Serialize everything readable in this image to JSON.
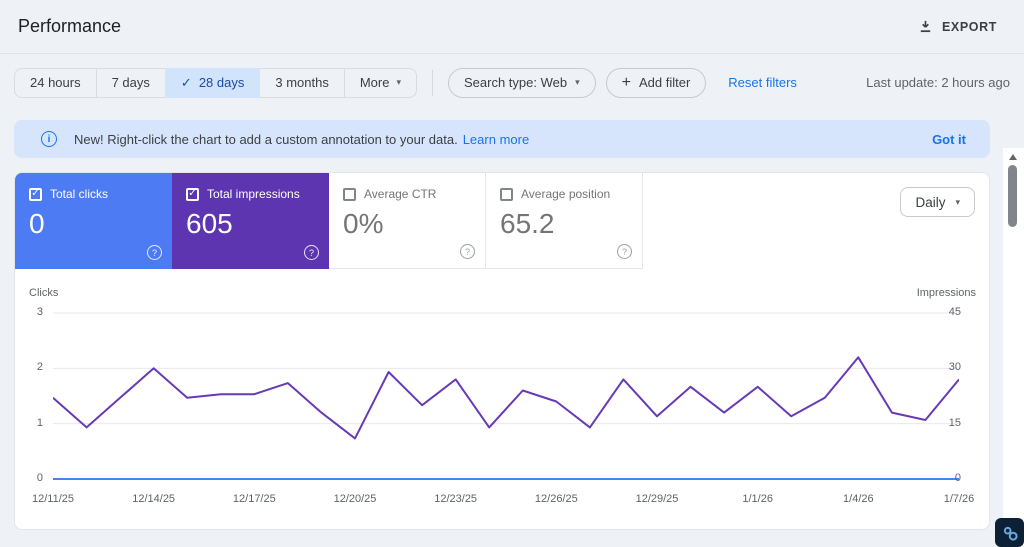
{
  "header": {
    "title": "Performance",
    "export_label": "EXPORT"
  },
  "filters": {
    "date_ranges": [
      {
        "label": "24 hours",
        "selected": false
      },
      {
        "label": "7 days",
        "selected": false
      },
      {
        "label": "28 days",
        "selected": true
      },
      {
        "label": "3 months",
        "selected": false
      },
      {
        "label": "More",
        "selected": false
      }
    ],
    "search_type_label": "Search type: Web",
    "add_filter_label": "Add filter",
    "reset_filters_label": "Reset filters",
    "last_update": "Last update: 2 hours ago"
  },
  "banner": {
    "text": "New! Right-click the chart to add a custom annotation to your data.",
    "learn_more_label": "Learn more",
    "dismiss_label": "Got it"
  },
  "metrics": {
    "cards": [
      {
        "label": "Total clicks",
        "value": "0",
        "checked": true
      },
      {
        "label": "Total impressions",
        "value": "605",
        "checked": true
      },
      {
        "label": "Average CTR",
        "value": "0%",
        "checked": false
      },
      {
        "label": "Average position",
        "value": "65.2",
        "checked": false
      }
    ],
    "granularity": "Daily"
  },
  "chart_data": {
    "type": "line",
    "title": "",
    "x": [
      "12/11/25",
      "12/12/25",
      "12/13/25",
      "12/14/25",
      "12/15/25",
      "12/16/25",
      "12/17/25",
      "12/18/25",
      "12/19/25",
      "12/20/25",
      "12/21/25",
      "12/22/25",
      "12/23/25",
      "12/24/25",
      "12/25/25",
      "12/26/25",
      "12/27/25",
      "12/28/25",
      "12/29/25",
      "12/30/25",
      "12/31/25",
      "1/1/26",
      "1/2/26",
      "1/3/26",
      "1/4/26",
      "1/5/26",
      "1/6/26",
      "1/7/26"
    ],
    "x_ticks": [
      {
        "index": 0,
        "label": "12/11/25"
      },
      {
        "index": 3,
        "label": "12/14/25"
      },
      {
        "index": 6,
        "label": "12/17/25"
      },
      {
        "index": 9,
        "label": "12/20/25"
      },
      {
        "index": 12,
        "label": "12/23/25"
      },
      {
        "index": 15,
        "label": "12/26/25"
      },
      {
        "index": 18,
        "label": "12/29/25"
      },
      {
        "index": 21,
        "label": "1/1/26"
      },
      {
        "index": 24,
        "label": "1/4/26"
      },
      {
        "index": 27,
        "label": "1/7/26"
      }
    ],
    "series": [
      {
        "name": "Total clicks",
        "axis": "left",
        "color": "#4285f4",
        "values": [
          0,
          0,
          0,
          0,
          0,
          0,
          0,
          0,
          0,
          0,
          0,
          0,
          0,
          0,
          0,
          0,
          0,
          0,
          0,
          0,
          0,
          0,
          0,
          0,
          0,
          0,
          0,
          0
        ]
      },
      {
        "name": "Total impressions",
        "axis": "right",
        "color": "#673ab7",
        "values": [
          22,
          14,
          22,
          30,
          22,
          23,
          23,
          26,
          18,
          11,
          29,
          20,
          27,
          14,
          24,
          21,
          14,
          27,
          17,
          25,
          18,
          25,
          17,
          22,
          33,
          18,
          16,
          27
        ]
      }
    ],
    "left_axis": {
      "label": "Clicks",
      "range": [
        0,
        3
      ],
      "ticks": [
        0,
        1,
        2,
        3
      ]
    },
    "right_axis": {
      "label": "Impressions",
      "range": [
        0,
        45
      ],
      "ticks": [
        0,
        15,
        30,
        45
      ]
    },
    "grid": true,
    "legend_position": "none"
  },
  "icons": {
    "check": "✓",
    "caret": "▾",
    "plus": "+",
    "info": "i",
    "help": "?"
  },
  "colors": {
    "clicks_card_bg": "#4d7bf3",
    "impressions_card_bg": "#5e35b1",
    "clicks_line": "#4285f4",
    "impressions_line": "#673ab7",
    "link_blue": "#1a73e8",
    "selected_chip_bg": "#d2e3fc",
    "selected_chip_text": "#174ea6",
    "banner_bg": "#d7e5fc"
  }
}
